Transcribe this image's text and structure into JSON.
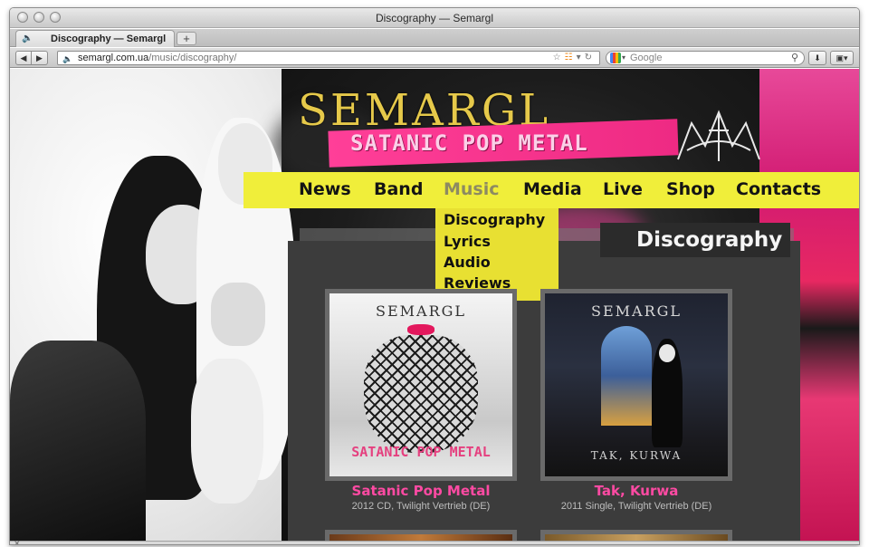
{
  "window": {
    "title": "Discography — Semargl"
  },
  "tabs": [
    {
      "label": "Discography — Semargl"
    }
  ],
  "toolbar": {
    "url_host": "semargl.com.ua",
    "url_path": "/music/discography/",
    "search_placeholder": "Google",
    "new_tab_label": "+"
  },
  "site": {
    "logo": "SEMARGL",
    "tagline": "SATANIC POP METAL",
    "nav": [
      "News",
      "Band",
      "Music",
      "Media",
      "Live",
      "Shop",
      "Contacts"
    ],
    "active_nav": "Music",
    "dropdown": [
      "Discography",
      "Lyrics",
      "Audio",
      "Reviews"
    ],
    "heading": "Discography",
    "albums": [
      {
        "title": "Satanic Pop Metal",
        "meta": "2012 CD, Twilight Vertrieb (DE)",
        "cover_band": "SEMARGL",
        "cover_text": "SATANIC POP METAL"
      },
      {
        "title": "Tak, Kurwa",
        "meta": "2011 Single, Twilight Vertrieb (DE)",
        "cover_band": "SEMARGL",
        "cover_text": "TAK, KURWA"
      }
    ]
  },
  "colors": {
    "nav_yellow": "#f0ee3a",
    "accent_pink": "#ff4aa3",
    "logo_gold": "#e6c94a"
  }
}
